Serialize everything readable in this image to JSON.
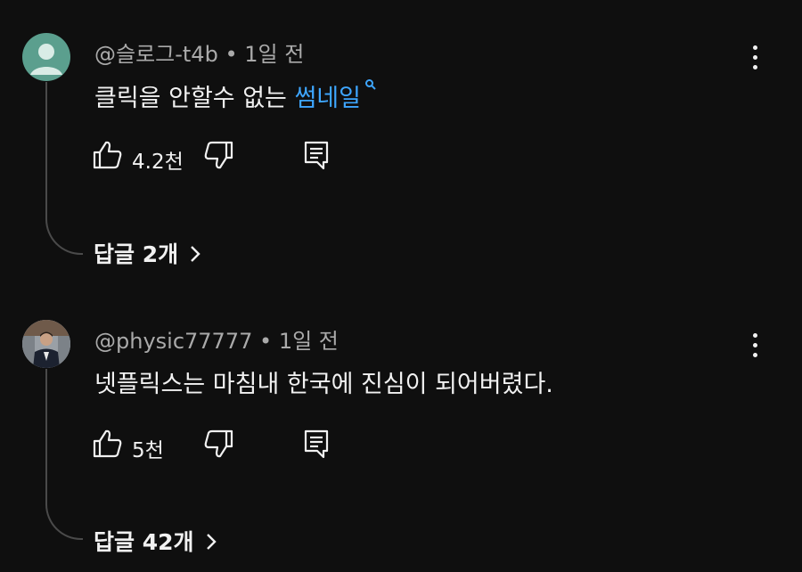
{
  "comments": [
    {
      "author": "@슬로그-t4b",
      "time": "1일 전",
      "text": "클릭을 안할수 없는 ",
      "link": "썸네일",
      "likes": "4.2천",
      "replies": "답글 2개",
      "avatar_color": "#5b9f8e"
    },
    {
      "author": "@physic77777",
      "time": "1일 전",
      "text": "넷플릭스는 마침내 한국에 진심이 되어버렸다.",
      "likes": "5천",
      "replies": "답글 42개"
    }
  ],
  "separator": "•",
  "icons": {
    "like": "thumb-up-icon",
    "dislike": "thumb-down-icon",
    "reply": "comment-icon",
    "more": "kebab-menu-icon",
    "search": "search-icon",
    "expand": "chevron-right-icon"
  }
}
